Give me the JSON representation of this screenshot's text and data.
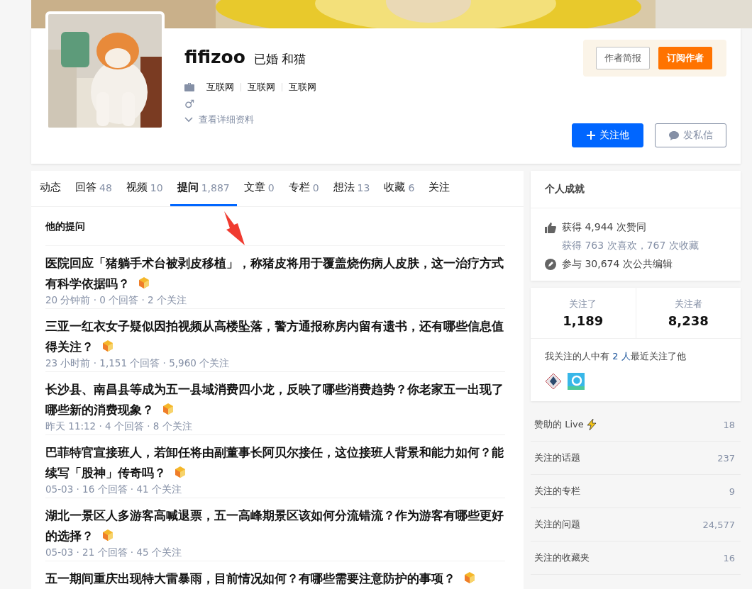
{
  "profile": {
    "name": "fifizoo",
    "headline": "已婚 和猫",
    "industries": [
      "互联网",
      "互联网",
      "互联网"
    ],
    "gender_symbol": "♂",
    "detail_link": "查看详细资料",
    "author_buttons": [
      {
        "kind": "outline",
        "label": "作者简报"
      },
      {
        "kind": "solid",
        "label": "订阅作者"
      }
    ],
    "actions": [
      {
        "kind": "follow",
        "label": "关注他"
      },
      {
        "kind": "message",
        "label": "发私信"
      }
    ]
  },
  "tabs": [
    {
      "label": "动态",
      "selected": false
    },
    {
      "label": "回答",
      "count": "48",
      "selected": false
    },
    {
      "label": "视频",
      "count": "10",
      "selected": false
    },
    {
      "label": "提问",
      "count": "1,887",
      "selected": true
    },
    {
      "label": "文章",
      "count": "0",
      "selected": false
    },
    {
      "label": "专栏",
      "count": "0",
      "selected": false
    },
    {
      "label": "想法",
      "count": "13",
      "selected": false
    },
    {
      "label": "收藏",
      "count": "6",
      "selected": false
    },
    {
      "label": "关注",
      "selected": false
    }
  ],
  "section_title": "他的提问",
  "questions": [
    {
      "title": "医院回应「猪躺手术台被剥皮移植」，称猪皮将用于覆盖烧伤病人皮肤，这一治疗方式有科学依据吗？",
      "meta": "20 分钟前 · 0 个回答 · 2 个关注"
    },
    {
      "title": "三亚一红衣女子疑似因拍视频从高楼坠落，警方通报称房内留有遗书，还有哪些信息值得关注？",
      "meta": "23 小时前 · 1,151 个回答 · 5,960 个关注"
    },
    {
      "title": "长沙县、南昌县等成为五一县域消费四小龙，反映了哪些消费趋势？你老家五一出现了哪些新的消费现象？",
      "meta": "昨天 11:12 · 4 个回答 · 8 个关注"
    },
    {
      "title": "巴菲特官宣接班人，若卸任将由副董事长阿贝尔接任，这位接班人背景和能力如何？能续写「股神」传奇吗？",
      "meta": "05-03 · 16 个回答 · 41 个关注"
    },
    {
      "title": "湖北一景区人多游客高喊退票，五一高峰期景区该如何分流错流？作为游客有哪些更好的选择？",
      "meta": "05-03 · 21 个回答 · 45 个关注"
    },
    {
      "title": "五一期间重庆出现特大雷暴雨，目前情况如何？有哪些需要注意防护的事项？"
    }
  ],
  "achievements": {
    "title": "个人成就",
    "items": [
      {
        "kind": "upvote",
        "text": "获得 4,944 次赞同"
      },
      {
        "kind": "sub",
        "text": "获得 763 次喜欢，767 次收藏"
      },
      {
        "kind": "edit",
        "text": "参与 30,674 次公共编辑"
      }
    ]
  },
  "follow_stats": [
    {
      "label": "关注了",
      "value": "1,189"
    },
    {
      "label": "关注者",
      "value": "8,238"
    }
  ],
  "mutual": {
    "before": "我关注的人中有 ",
    "link": "2 人",
    "after": "最近关注了他"
  },
  "side_links": [
    {
      "label": "赞助的 Live",
      "count": "18",
      "kind": "live"
    },
    {
      "label": "关注的话题",
      "count": "237",
      "kind": "plain"
    },
    {
      "label": "关注的专栏",
      "count": "9",
      "kind": "plain"
    },
    {
      "label": "关注的问题",
      "count": "24,577",
      "kind": "plain"
    },
    {
      "label": "关注的收藏夹",
      "count": "16",
      "kind": "plain"
    }
  ]
}
